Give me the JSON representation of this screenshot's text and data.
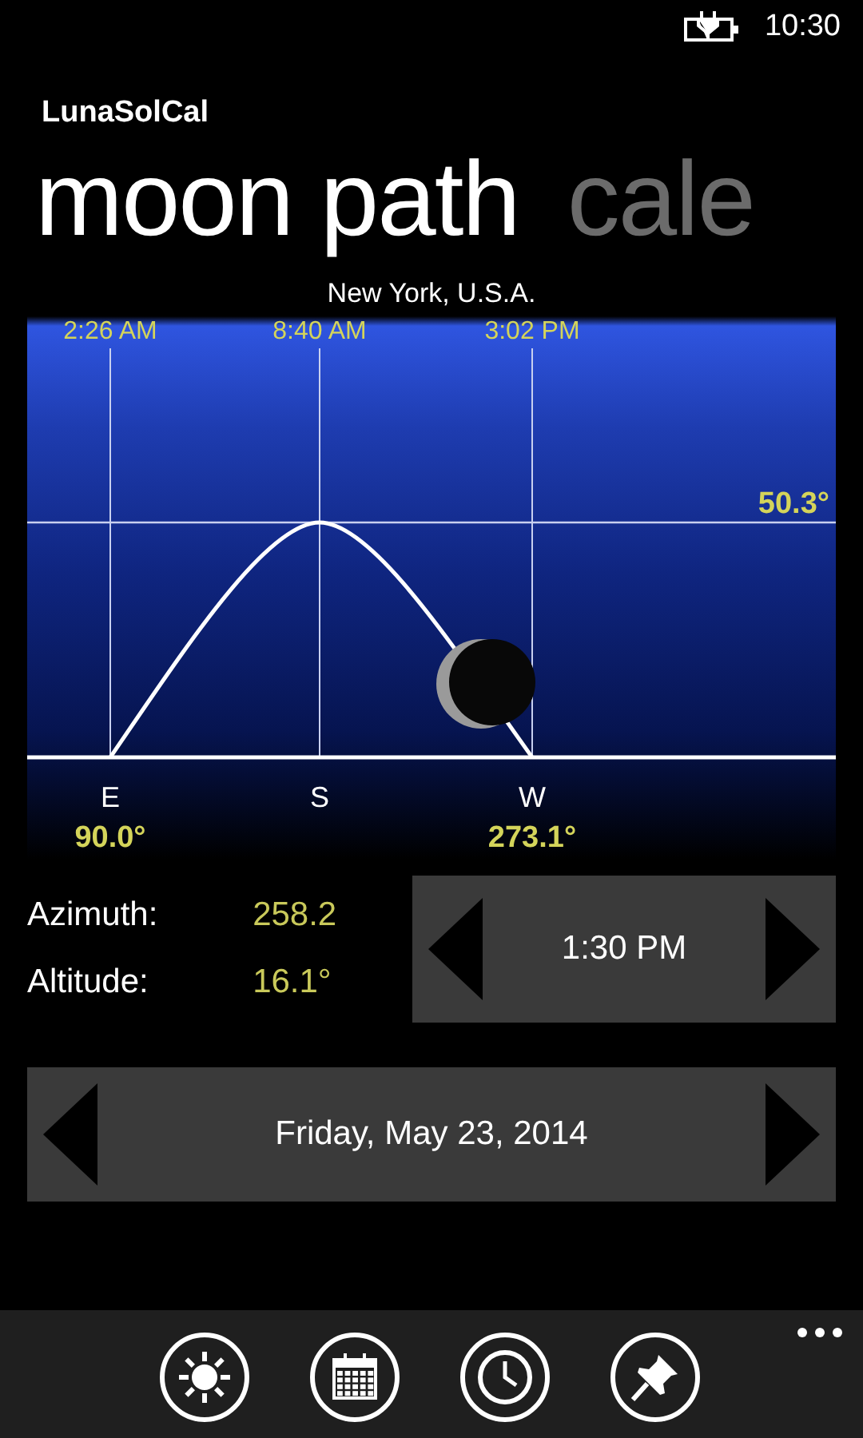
{
  "status_bar": {
    "time": "10:30"
  },
  "app_title": "LunaSolCal",
  "pivot": [
    {
      "label": "moon path",
      "selected": true
    },
    {
      "label": "cale",
      "selected": false
    }
  ],
  "location": "New York, U.S.A.",
  "moon_path": {
    "rise": {
      "time": "2:26 AM",
      "direction": "E",
      "azimuth": "90.0°"
    },
    "transit": {
      "time": "8:40 AM",
      "direction": "S"
    },
    "set": {
      "time": "3:02 PM",
      "direction": "W",
      "azimuth": "273.1°"
    },
    "max_altitude": "50.3°"
  },
  "readings": [
    {
      "label": "Azimuth:",
      "value": "258.2"
    },
    {
      "label": "Altitude:",
      "value": "16.1°"
    }
  ],
  "time_selector": {
    "value": "1:30 PM"
  },
  "date_selector": {
    "value": "Friday, May 23, 2014"
  }
}
